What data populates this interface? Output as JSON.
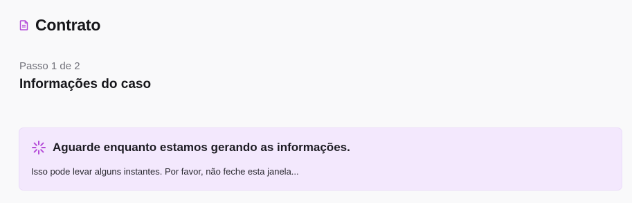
{
  "header": {
    "icon": "document-icon",
    "title": "Contrato"
  },
  "step": {
    "label": "Passo 1 de 2",
    "title": "Informações do caso"
  },
  "notice": {
    "icon": "loading-spinner-icon",
    "title": "Aguarde enquanto estamos gerando as informações.",
    "text": "Isso pode levar alguns instantes. Por favor, não feche esta janela...",
    "accent_color": "#b44bd8",
    "background_color": "#f3e8fd"
  }
}
